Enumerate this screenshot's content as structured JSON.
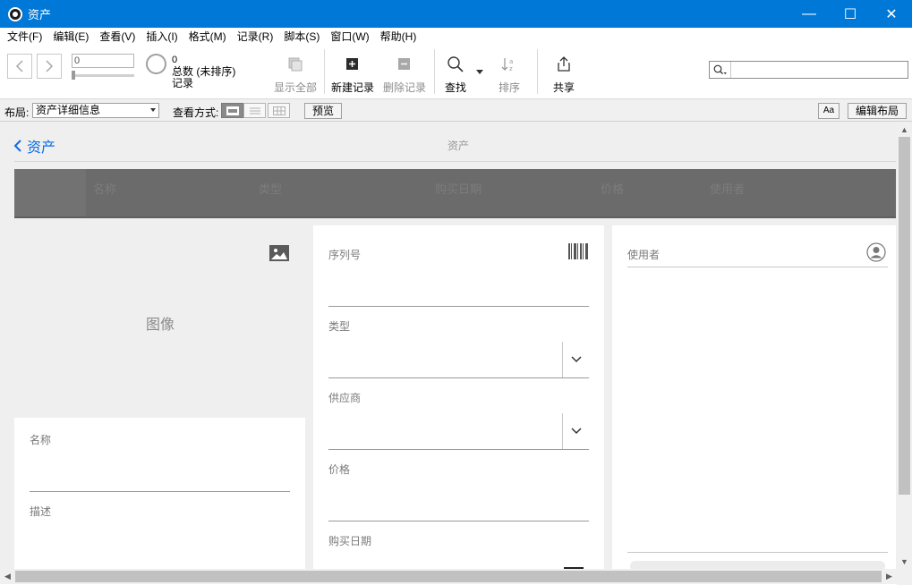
{
  "window": {
    "title": "资产",
    "minimize": "—",
    "maximize": "☐",
    "close": "✕"
  },
  "menu": [
    "文件(F)",
    "编辑(E)",
    "查看(V)",
    "插入(I)",
    "格式(M)",
    "记录(R)",
    "脚本(S)",
    "窗口(W)",
    "帮助(H)"
  ],
  "toolbar": {
    "record_value": "0",
    "total_count": "0",
    "total_label": "总数 (未排序)",
    "records_label": "记录",
    "show_all": "显示全部",
    "new_record": "新建记录",
    "delete_record": "删除记录",
    "find": "查找",
    "sort": "排序",
    "share": "共享",
    "search_value": ""
  },
  "layout_bar": {
    "layout_label": "布局:",
    "layout_value": "资产详细信息",
    "view_as_label": "查看方式:",
    "preview": "预览",
    "aa": "Aa",
    "edit_layout": "编辑布局"
  },
  "content": {
    "back_label": "资产",
    "center_title": "资产",
    "header_columns": [
      "名称",
      "类型",
      "购买日期",
      "价格",
      "使用者"
    ],
    "image_label": "图像",
    "left_fields": [
      "名称",
      "描述"
    ],
    "middle_fields": [
      "序列号",
      "类型",
      "供应商",
      "价格",
      "购买日期"
    ],
    "right_fields": [
      "使用者"
    ]
  }
}
